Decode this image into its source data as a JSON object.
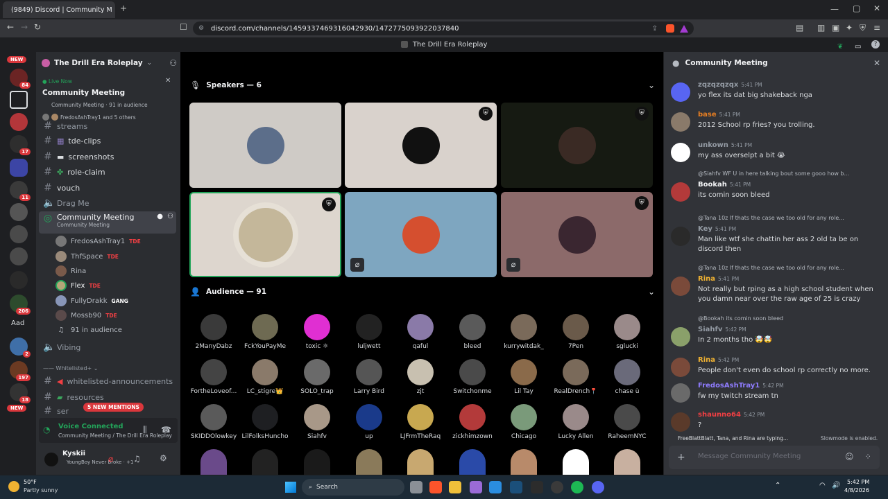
{
  "browser": {
    "tab_title": "(9849) Discord | Community M",
    "url": "discord.com/channels/1459337469316042930/1472775093922037840",
    "new_tab": "+"
  },
  "discord_title": "The Drill Era Roleplay",
  "rail": {
    "new_label": "NEW",
    "badges": [
      "84",
      "17",
      "11",
      "206",
      "2",
      "197",
      "18"
    ],
    "aad": "Aad",
    "new_bottom": "NEW",
    "new_mentions": "5 NEW MENTIONS"
  },
  "server": {
    "name": "The Drill Era Roleplay",
    "live_now": "Live Now",
    "live_title": "Community Meeting",
    "live_sub": "Community Meeting · 91 in audience",
    "live_people": "FredosAshTray1 and 5 others"
  },
  "channels": [
    {
      "name": "streams"
    },
    {
      "name": "tde-clips"
    },
    {
      "name": "screenshots"
    },
    {
      "name": "role-claim"
    },
    {
      "name": "vouch"
    }
  ],
  "voice": {
    "drag_me": "Drag Me",
    "meeting": "Community Meeting",
    "meeting_sub": "Community Meeting",
    "users": [
      {
        "name": "FredosAshTray1",
        "tag": "TDE"
      },
      {
        "name": "ThfSpace",
        "tag": "TDE"
      },
      {
        "name": "Rina",
        "tag": ""
      },
      {
        "name": "Flex",
        "tag": "TDE"
      },
      {
        "name": "FullyDrakk",
        "tag": "GANG"
      },
      {
        "name": "Mossb90",
        "tag": "TDE"
      }
    ],
    "audience": "91 in audience",
    "vibing": "Vibing",
    "category": "Whitelisted+",
    "wl_channels": [
      "whitelisted-announcements",
      "resources",
      "ser"
    ]
  },
  "voice_connected": {
    "title": "Voice Connected",
    "sub": "Community Meeting / The Drill Era Roleplay"
  },
  "user": {
    "name": "Kyskii",
    "status": "YoungBoy Never Broke · +1"
  },
  "stage": {
    "speakers_label": "Speakers — 6",
    "audience_label": "Audience — 91",
    "speaker_colors": [
      "#cfcbc6",
      "#d9d2cc",
      "#161a12",
      "#ddd6ce",
      "#7ea6c0",
      "#8c6a6a"
    ],
    "audience": [
      "2ManyDabz",
      "FckYouPayMe",
      "toxic ⚛",
      "luljwett",
      "qaful",
      "bleed",
      "kurrywitdak_",
      "7Pen",
      "sglucki",
      "FortheLoveof...",
      "LC_stigre👑",
      "SOLO_trap",
      "Larry Bird",
      "zjt",
      "Switchonme",
      "Lil Tay",
      "RealDrench📍",
      "chase ù",
      "SKIDDOlowkey",
      "LilFolksHuncho",
      "Siahfv",
      "up",
      "LJFrmTheRaq",
      "zickhimzown",
      "Chicago",
      "Lucky Allen",
      "RaheemNYC"
    ]
  },
  "chat": {
    "title": "Community Meeting",
    "messages": [
      {
        "name": "zqzqzqzqx",
        "time": "5:41 PM",
        "text": "yo flex its dat big shakeback nga",
        "color": "#949ba4",
        "reply": ""
      },
      {
        "name": "base",
        "time": "5:41 PM",
        "text": "2012 School rp fries? you trolling.",
        "color": "#e67e22",
        "reply": ""
      },
      {
        "name": "unkown",
        "time": "5:41 PM",
        "text": "my ass overselpt a bit 😭",
        "color": "#949ba4",
        "reply": ""
      },
      {
        "name": "Bookah",
        "time": "5:41 PM",
        "text": "its comin soon bleed",
        "color": "#f2f3f5",
        "reply": "@Siahfv  WF  U in here talking bout some gooo how b..."
      },
      {
        "name": "Key",
        "time": "5:41 PM",
        "text": "Man like wtf she chattin her ass 2 old ta be on discord then",
        "color": "#949ba4",
        "reply": "@Tana  10z  If thats the case we too old for any role..."
      },
      {
        "name": "Rina",
        "time": "5:41 PM",
        "text": "Not really but rping as a high school student when you damn near over the raw age of 25 is crazy",
        "color": "#f0b232",
        "reply": "@Tana  10z  If thats the case we too old for any role..."
      },
      {
        "name": "Siahfv",
        "time": "5:42 PM",
        "text": "In 2 months tho 🤯🤯",
        "color": "#949ba4",
        "reply": "@Bookah its comin soon bleed"
      },
      {
        "name": "Rina",
        "time": "5:42 PM",
        "text": "People don't even do school rp correctly no more.",
        "color": "#f0b232",
        "reply": ""
      },
      {
        "name": "FredosAshTray1",
        "time": "5:42 PM",
        "text": "fw my twitch stream tn",
        "color": "#8f7cff",
        "reply": ""
      },
      {
        "name": "shaunno64",
        "time": "5:42 PM",
        "text": "?",
        "color": "#f23f43",
        "reply": ""
      }
    ],
    "typing": "FreeBlattBlatt, Tana, and Rina are typing...",
    "slowmode": "Slowmode is enabled.",
    "placeholder": "Message Community Meeting"
  },
  "taskbar": {
    "weather_temp": "50°F",
    "weather_desc": "Partly sunny",
    "search": "Search",
    "time": "5:42 PM",
    "date": "4/8/2026"
  }
}
